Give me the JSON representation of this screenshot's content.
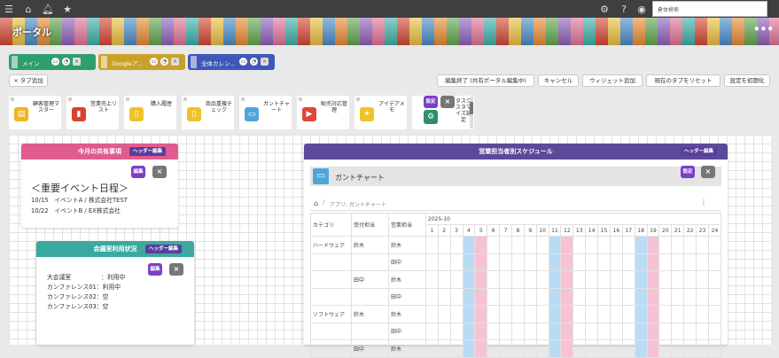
{
  "topbar": {
    "search_placeholder": "全体検索",
    "menu_icon": "hamburger-icon",
    "home_icon": "home-icon",
    "bell_icon": "bell-icon",
    "star_icon": "star-icon",
    "gear_icon": "gear-icon",
    "help_icon": "help-icon",
    "user_icon": "user-icon",
    "search_icon": "search-icon"
  },
  "banner": {
    "title": "ポータル",
    "more": "•••"
  },
  "tabs": [
    {
      "label": "メイン",
      "color": "#2f9e6e"
    },
    {
      "label": "Googleア...",
      "color": "#c9a12a"
    },
    {
      "label": "全体カレン...",
      "color": "#3f57b8"
    }
  ],
  "tab_add_label": "× タブ追加",
  "actions": {
    "end_edit": "編集終了 (共有ポータル編集中)",
    "cancel": "キャンセル",
    "add_widget": "ウィジェット追加",
    "reset_tab": "現在のタブをリセット",
    "init_settings": "設定を初期化"
  },
  "shortcuts": [
    {
      "label": "顧客管理マスター",
      "icon": "user-card-icon",
      "color": "#f0b323"
    },
    {
      "label": "営業売上リスト",
      "icon": "chart-icon",
      "color": "#d9432e"
    },
    {
      "label": "購入履歴",
      "icon": "document-icon",
      "color": "#f0c22a"
    },
    {
      "label": "商品重複チェック",
      "icon": "document-icon",
      "color": "#f0c22a"
    },
    {
      "label": "ガントチャート",
      "icon": "monitor-icon",
      "color": "#4fa5d8"
    },
    {
      "label": "販売対応管理",
      "icon": "video-icon",
      "color": "#e0453a"
    },
    {
      "label": "アイデアメモ",
      "icon": "bulb-icon",
      "color": "#f0c22a"
    },
    {
      "label": "タスクスタマイズ設定",
      "icon": "gear-cluster-icon",
      "color": "#2d8f6f"
    }
  ],
  "shortcut_buttons": {
    "settings": "設定",
    "close": "×"
  },
  "widgets": {
    "shared": {
      "title": "今月の共有事項",
      "header_badge": "ヘッダー編集",
      "edit": "編集",
      "close": "×",
      "heading": "＜重要イベント日程＞",
      "lines": [
        "10/15　イベントA / 株式会社TEST",
        "10/22　イベントB / EX株式会社"
      ],
      "color": "#e05c8e"
    },
    "meeting": {
      "title": "会議室利用状況",
      "header_badge": "ヘッダー編集",
      "edit": "編集",
      "close": "×",
      "lines": [
        "大会議室　　　　　：利用中",
        "カンファレンス01：利用中",
        "カンファレンス02：空",
        "カンファレンス03：空"
      ],
      "color": "#3aa99f"
    },
    "schedule": {
      "title": "営業担当者別スケジュール",
      "header_badge": "ヘッダー編集",
      "settings": "設定",
      "close": "×",
      "app_title": "ガントチャート",
      "crumb": "アプリ: ガントチャート",
      "more_icon": "⋮",
      "color": "#5b4a9a"
    }
  },
  "gantt": {
    "headers": {
      "category": "カテゴリ",
      "receiver": "受付担当",
      "sales": "営業担当",
      "month": "2025-10"
    },
    "days": [
      "1",
      "2",
      "3",
      "4",
      "5",
      "6",
      "7",
      "8",
      "9",
      "10",
      "11",
      "12",
      "13",
      "14",
      "15",
      "16",
      "17",
      "18",
      "19",
      "20",
      "21",
      "22",
      "23",
      "24"
    ],
    "blue_days": [
      "4",
      "11",
      "18"
    ],
    "pink_days": [
      "5",
      "12",
      "19"
    ],
    "rows": [
      {
        "category": "ハードウェア",
        "receiver": "鈴木",
        "sales": "鈴木"
      },
      {
        "category": "",
        "receiver": "",
        "sales": "田中"
      },
      {
        "category": "",
        "receiver": "田中",
        "sales": "鈴木"
      },
      {
        "category": "",
        "receiver": "",
        "sales": "田中"
      },
      {
        "category": "ソフトウェア",
        "receiver": "鈴木",
        "sales": "鈴木"
      },
      {
        "category": "",
        "receiver": "",
        "sales": "田中"
      },
      {
        "category": "",
        "receiver": "田中",
        "sales": "鈴木"
      }
    ]
  }
}
